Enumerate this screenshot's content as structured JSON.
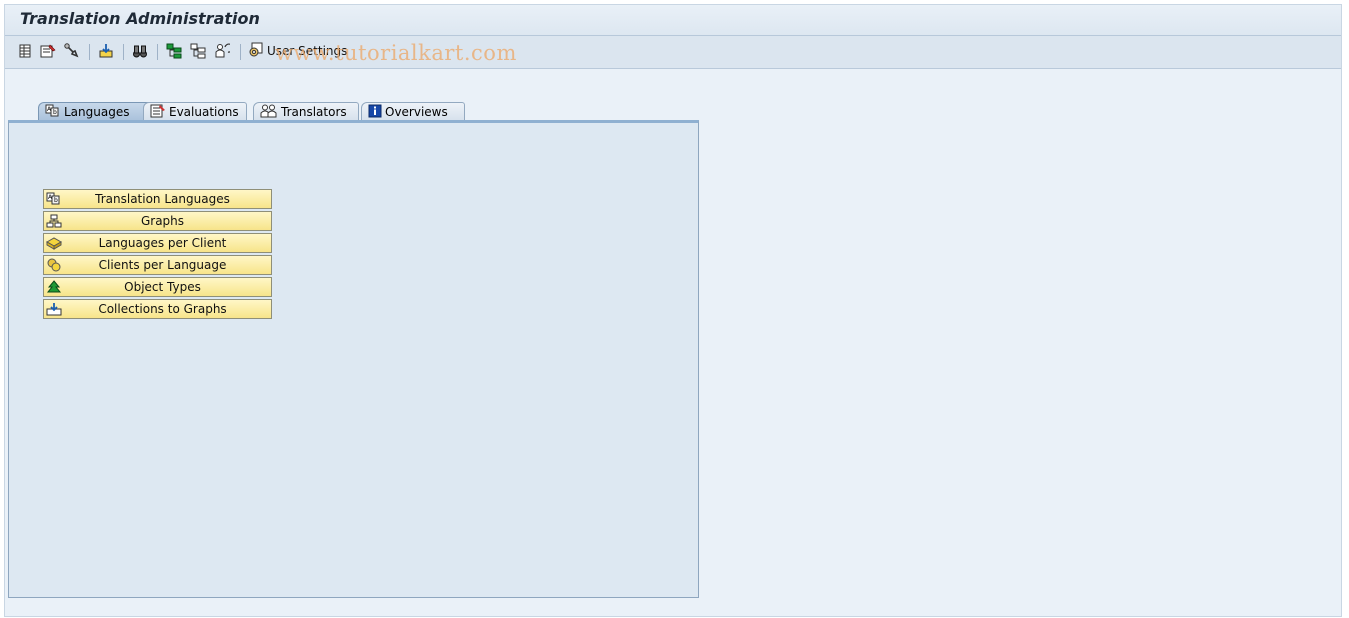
{
  "window": {
    "title": "Translation Administration"
  },
  "toolbar": {
    "icons": [
      "table-icon",
      "tools-list-icon",
      "wrench-icon",
      "import-icon",
      "binoculars-icon",
      "tree-expand-icon",
      "tree-collapse-icon",
      "people-refresh-icon"
    ],
    "user_settings_label": "User Settings",
    "watermark": "www.tutorialkart.com"
  },
  "tabs": [
    {
      "label": "Languages",
      "icon": "languages-icon",
      "active": true
    },
    {
      "label": "Evaluations",
      "icon": "evaluations-icon",
      "active": false
    },
    {
      "label": "Translators",
      "icon": "translators-icon",
      "active": false
    },
    {
      "label": "Overviews",
      "icon": "info-icon",
      "active": false
    }
  ],
  "menu": [
    {
      "label": "Translation Languages",
      "icon": "languages-icon"
    },
    {
      "label": "Graphs",
      "icon": "hierarchy-icon"
    },
    {
      "label": "Languages per Client",
      "icon": "yellow-box-icon"
    },
    {
      "label": "Clients per Language",
      "icon": "coins-icon"
    },
    {
      "label": "Object Types",
      "icon": "green-tree-icon"
    },
    {
      "label": "Collections to Graphs",
      "icon": "collection-icon"
    }
  ],
  "colors": {
    "button_fill": "#f7e48a",
    "active_tab": "#a9c1db",
    "panel": "#dde8f2"
  }
}
